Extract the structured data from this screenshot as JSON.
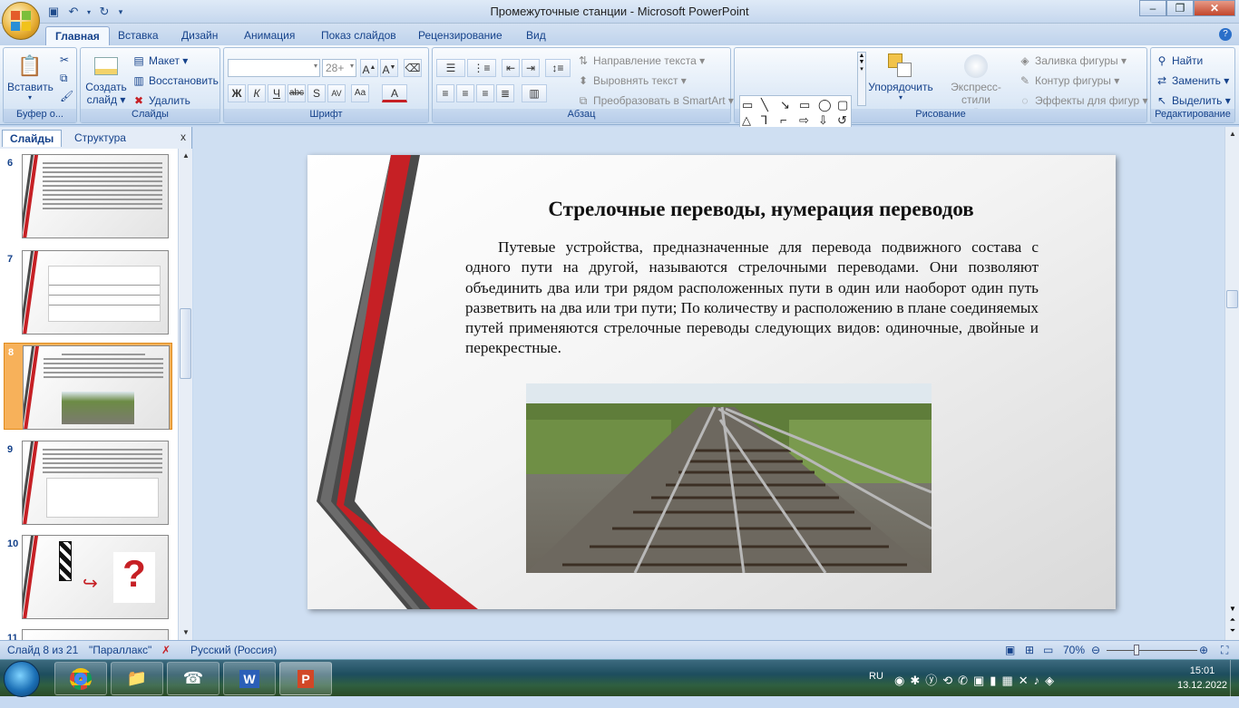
{
  "window": {
    "title": "Промежуточные станции - Microsoft PowerPoint"
  },
  "qat": {
    "save_icon": "save-icon",
    "undo_icon": "undo-icon",
    "redo_icon": "redo-icon"
  },
  "tabs": [
    "Главная",
    "Вставка",
    "Дизайн",
    "Анимация",
    "Показ слайдов",
    "Рецензирование",
    "Вид"
  ],
  "active_tab": "Главная",
  "ribbon": {
    "clipboard": {
      "paste": "Вставить",
      "group": "Буфер о..."
    },
    "slides": {
      "new_slide_line1": "Создать",
      "new_slide_line2": "слайд ▾",
      "layout": "Макет ▾",
      "reset": "Восстановить",
      "delete": "Удалить",
      "group": "Слайды"
    },
    "font": {
      "font_name": "",
      "font_size": "28+",
      "group": "Шрифт"
    },
    "paragraph": {
      "text_direction": "Направление текста ▾",
      "align_text": "Выровнять текст ▾",
      "smartart": "Преобразовать в SmartArt ▾",
      "group": "Абзац"
    },
    "drawing": {
      "arrange": "Упорядочить",
      "quick_styles": "Экспресс-стили",
      "fill": "Заливка фигуры ▾",
      "outline": "Контур фигуры ▾",
      "effects": "Эффекты для фигур ▾",
      "group": "Рисование"
    },
    "editing": {
      "find": "Найти",
      "replace": "Заменить ▾",
      "select": "Выделить ▾",
      "group": "Редактирование"
    }
  },
  "panel": {
    "tab_slides": "Слайды",
    "tab_outline": "Структура"
  },
  "thumbnails": [
    {
      "num": "6",
      "selected": false
    },
    {
      "num": "7",
      "selected": false
    },
    {
      "num": "8",
      "selected": true
    },
    {
      "num": "9",
      "selected": false
    },
    {
      "num": "10",
      "selected": false
    },
    {
      "num": "11",
      "selected": false
    }
  ],
  "slide": {
    "title": "Стрелочные переводы, нумерация переводов",
    "body": "Путевые устройства, предназначенные для перевода подвижного состава с одного пути на другой, называются стрелочными переводами. Они позволяют объединить два или три рядом расположенных пути в один или наоборот один путь разветвить на два или три пути; По количеству и расположению в плане соединяемых путей применяются стрелочные переводы следующих видов: одиночные, двойные и перекрестные.",
    "image": "railway-switch-photo"
  },
  "status": {
    "slide_count": "Слайд 8 из 21",
    "theme": "\"Параллакс\"",
    "language": "Русский (Россия)",
    "zoom": "70%"
  },
  "taskbar": {
    "lang": "RU",
    "time": "15:01",
    "date": "13.12.2022"
  },
  "colors": {
    "accent_red": "#c62025",
    "dark_stripe": "#4a4a4a",
    "ribbon_text": "#15428b"
  }
}
